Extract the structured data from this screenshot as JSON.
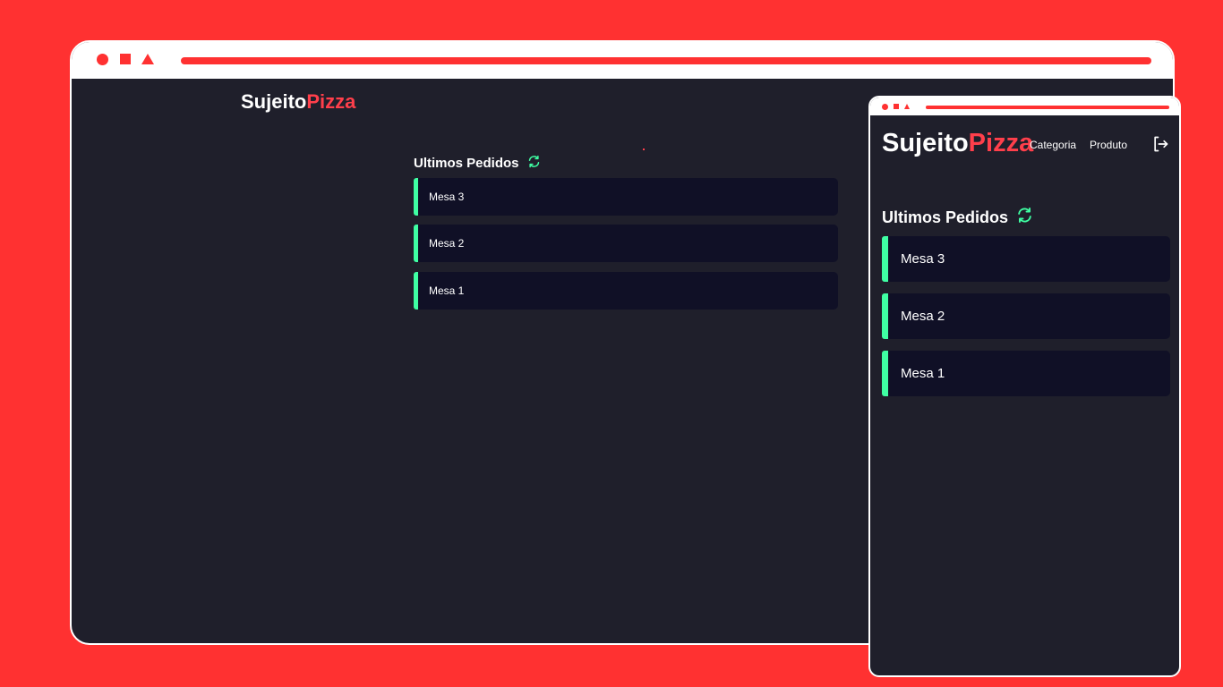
{
  "desktop": {
    "logo": {
      "part1": "Sujeito",
      "part2": "Pizza"
    },
    "section": {
      "title": "Ultimos Pedidos",
      "refresh_icon": "refresh-icon"
    },
    "orders": [
      {
        "label": "Mesa 3"
      },
      {
        "label": "Mesa 2"
      },
      {
        "label": "Mesa 1"
      }
    ]
  },
  "mobile": {
    "logo": {
      "part1": "Sujeito",
      "part2": "Pizza"
    },
    "nav": {
      "categoria": "Categoria",
      "produto": "Produto",
      "logout_icon": "logout-icon"
    },
    "section": {
      "title": "Ultimos Pedidos",
      "refresh_icon": "refresh-icon"
    },
    "orders": [
      {
        "label": "Mesa 3"
      },
      {
        "label": "Mesa 2"
      },
      {
        "label": "Mesa 1"
      }
    ]
  },
  "colors": {
    "background": "#ff3131",
    "app_bg": "#1f1f2b",
    "card_bg": "#101026",
    "accent_green": "#3fffa3",
    "brand_red": "#ff3f4b"
  }
}
